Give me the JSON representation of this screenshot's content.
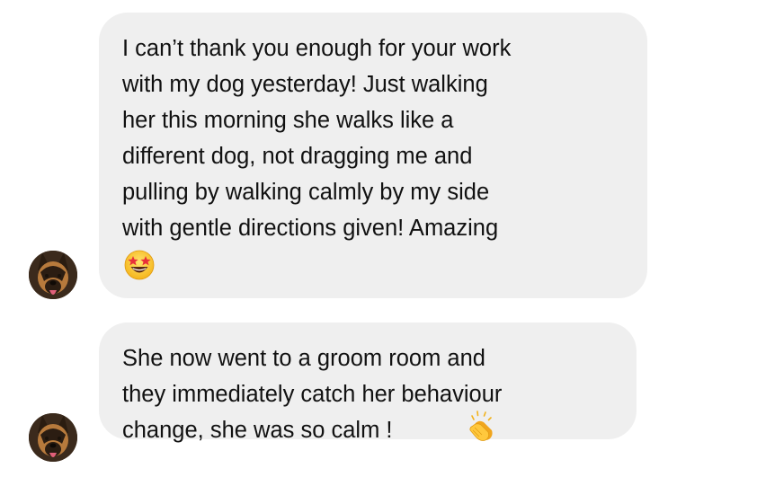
{
  "messages": [
    {
      "text": "I can’t thank you enough for your work\nwith my dog yesterday! Just walking\nher this morning she walks like a\ndifferent dog, not dragging me and\npulling by walking calmly by my side\nwith gentle directions given! Amazing",
      "emoji": "star-struck-emoji-icon",
      "avatar": "dog-avatar"
    },
    {
      "text": "She now went to a groom room and\nthey immediately catch her behaviour\nchange, she was so calm !",
      "emoji": "clapping-hands-emoji-icon",
      "avatar": "dog-avatar"
    }
  ],
  "colors": {
    "bubble": "#efefef",
    "text": "#111111",
    "background": "#ffffff"
  }
}
